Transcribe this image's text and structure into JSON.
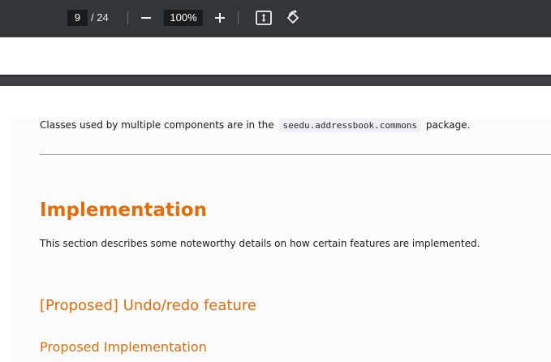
{
  "toolbar": {
    "current_page": "9",
    "total_pages": "/ 24",
    "zoom_level": "100%",
    "icons": {
      "zoom_out": "minus-icon",
      "zoom_in": "plus-icon",
      "fit": "fit-to-page-icon",
      "rotate": "rotate-icon"
    }
  },
  "document": {
    "commons_text_before": "Classes used by multiple components are in the",
    "commons_code": "seedu.addressbook.commons",
    "commons_text_after": "package.",
    "implementation_heading": "Implementation",
    "implementation_desc": "This section describes some noteworthy details on how certain features are implemented.",
    "undo_redo_heading": "[Proposed] Undo/redo feature",
    "proposed_impl_heading": "Proposed Implementation"
  },
  "colors": {
    "toolbar_bg": "#323639",
    "heading_orange": "#e46c0a"
  }
}
